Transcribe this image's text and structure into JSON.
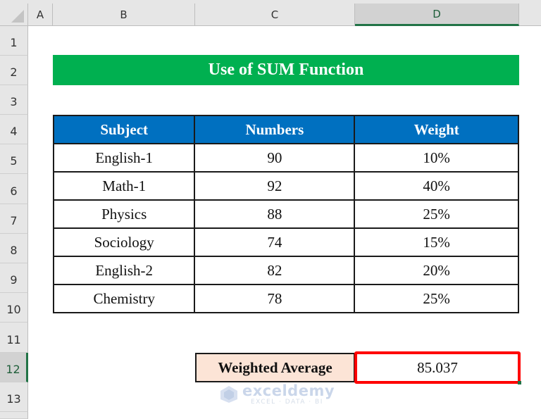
{
  "sheet": {
    "columns": [
      "A",
      "B",
      "C",
      "D"
    ],
    "selected_column": "D",
    "rows": [
      "1",
      "2",
      "3",
      "4",
      "5",
      "6",
      "7",
      "8",
      "9",
      "10",
      "11",
      "12",
      "13"
    ],
    "selected_row": "12"
  },
  "title": "Use of SUM Function",
  "table": {
    "headers": [
      "Subject",
      "Numbers",
      "Weight"
    ],
    "rows": [
      [
        "English-1",
        "90",
        "10%"
      ],
      [
        "Math-1",
        "92",
        "40%"
      ],
      [
        "Physics",
        "88",
        "25%"
      ],
      [
        "Sociology",
        "74",
        "15%"
      ],
      [
        "English-2",
        "82",
        "20%"
      ],
      [
        "Chemistry",
        "78",
        "25%"
      ]
    ]
  },
  "result": {
    "label": "Weighted Average",
    "value": "85.037"
  },
  "watermark": {
    "brand": "exceldemy",
    "tagline": "EXCEL · DATA · BI"
  },
  "colors": {
    "title_bg": "#00b050",
    "header_bg": "#0070c0",
    "label_bg": "#fce4d6",
    "highlight_border": "#ff0000",
    "selection": "#217346"
  }
}
